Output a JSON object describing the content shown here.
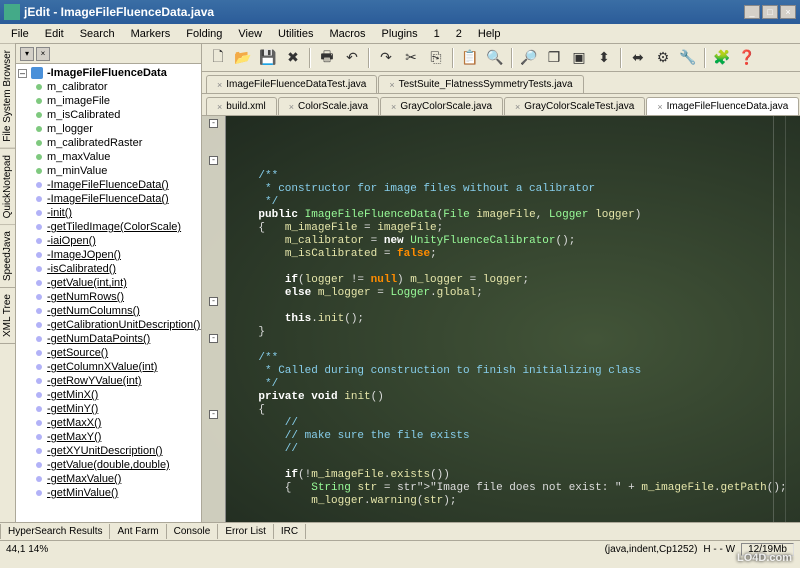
{
  "window": {
    "title": "jEdit - ImageFileFluenceData.java",
    "minimize": "_",
    "maximize": "□",
    "close": "×"
  },
  "menu": [
    "File",
    "Edit",
    "Search",
    "Markers",
    "Folding",
    "View",
    "Utilities",
    "Macros",
    "Plugins",
    "1",
    "2",
    "Help"
  ],
  "toolbar_icons": [
    "new",
    "open",
    "save",
    "close",
    "print",
    "undo",
    "redo",
    "cut",
    "copy",
    "paste",
    "find",
    "find-next",
    "new-view",
    "unsplit",
    "split-horiz",
    "split-vert",
    "props",
    "plugin-opts",
    "plugin-mgr",
    "help"
  ],
  "left_dock_tabs": [
    "File System Browser",
    "QuickNotepad",
    "SpeedJava",
    "XML Tree"
  ],
  "sidebar": {
    "root": "-ImageFileFluenceData",
    "items": [
      {
        "label": "m_calibrator",
        "kind": "field"
      },
      {
        "label": "m_imageFile",
        "kind": "field"
      },
      {
        "label": "m_isCalibrated",
        "kind": "field"
      },
      {
        "label": "m_logger",
        "kind": "field"
      },
      {
        "label": "m_calibratedRaster",
        "kind": "field"
      },
      {
        "label": "m_maxValue",
        "kind": "field"
      },
      {
        "label": "m_minValue",
        "kind": "field"
      },
      {
        "label": "-ImageFileFluenceData()",
        "kind": "method",
        "u": true
      },
      {
        "label": "-ImageFileFluenceData()",
        "kind": "method",
        "u": true
      },
      {
        "label": "-init()",
        "kind": "method",
        "u": true
      },
      {
        "label": "-getTiledImage(ColorScale)",
        "kind": "method",
        "u": true
      },
      {
        "label": "-iaiOpen()",
        "kind": "method",
        "u": true
      },
      {
        "label": "-ImageJOpen()",
        "kind": "method",
        "u": true
      },
      {
        "label": "-isCalibrated()",
        "kind": "method",
        "u": true
      },
      {
        "label": "-getValue(int,int)",
        "kind": "method",
        "u": true
      },
      {
        "label": "-getNumRows()",
        "kind": "method",
        "u": true
      },
      {
        "label": "-getNumColumns()",
        "kind": "method",
        "u": true
      },
      {
        "label": "-getCalibrationUnitDescription()",
        "kind": "method",
        "u": true
      },
      {
        "label": "-getNumDataPoints()",
        "kind": "method",
        "u": true
      },
      {
        "label": "-getSource()",
        "kind": "method",
        "u": true
      },
      {
        "label": "-getColumnXValue(int)",
        "kind": "method",
        "u": true
      },
      {
        "label": "-getRowYValue(int)",
        "kind": "method",
        "u": true
      },
      {
        "label": "-getMinX()",
        "kind": "method",
        "u": true
      },
      {
        "label": "-getMinY()",
        "kind": "method",
        "u": true
      },
      {
        "label": "-getMaxX()",
        "kind": "method",
        "u": true
      },
      {
        "label": "-getMaxY()",
        "kind": "method",
        "u": true
      },
      {
        "label": "-getXYUnitDescription()",
        "kind": "method",
        "u": true
      },
      {
        "label": "-getValue(double,double)",
        "kind": "method",
        "u": true
      },
      {
        "label": "-getMaxValue()",
        "kind": "method",
        "u": true
      },
      {
        "label": "-getMinValue()",
        "kind": "method",
        "u": true
      }
    ]
  },
  "tabs_row1": [
    {
      "label": "ImageFileFluenceDataTest.java",
      "active": false
    },
    {
      "label": "TestSuite_FlatnessSymmetryTests.java",
      "active": false
    }
  ],
  "tabs_row2": [
    {
      "label": "build.xml",
      "active": false
    },
    {
      "label": "ColorScale.java",
      "active": false
    },
    {
      "label": "GrayColorScale.java",
      "active": false
    },
    {
      "label": "GrayColorScaleTest.java",
      "active": false
    },
    {
      "label": "ImageFileFluenceData.java",
      "active": true
    }
  ],
  "code_lines": [
    "    /**",
    "     * constructor for image files without a calibrator",
    "     */",
    "    public ImageFileFluenceData(File imageFile, Logger logger)",
    "    {   m_imageFile = imageFile;",
    "        m_calibrator = new UnityFluenceCalibrator();",
    "        m_isCalibrated = false;",
    "",
    "        if(logger != null) m_logger = logger;",
    "        else m_logger = Logger.global;",
    "",
    "        this.init();",
    "    }",
    "",
    "    /**",
    "     * Called during construction to finish initializing class",
    "     */",
    "    private void init()",
    "    {",
    "        //",
    "        // make sure the file exists",
    "        //",
    "",
    "        if(!m_imageFile.exists())",
    "        {   String str = \"Image file does not exist: \" + m_imageFile.getPath();",
    "            m_logger.warning(str);"
  ],
  "bottom_tabs": [
    "HyperSearch Results",
    "Ant Farm",
    "Console",
    "Error List",
    "IRC"
  ],
  "status": {
    "pos": "44,1 14%",
    "enc": "(java,indent,Cp1252)",
    "mode": "H - - W",
    "mem": "12/19Mb"
  },
  "watermark": "LO4D.com"
}
